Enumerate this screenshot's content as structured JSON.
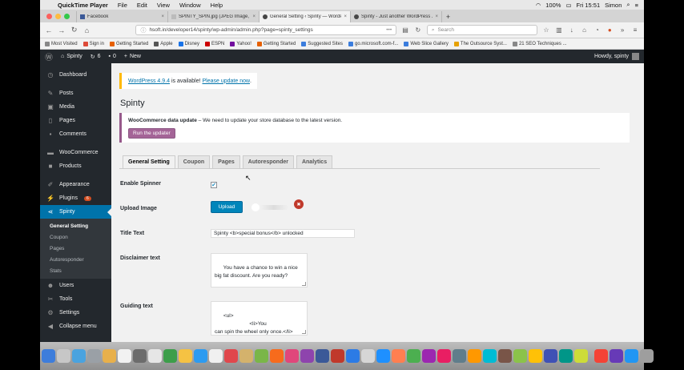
{
  "mac_menubar": {
    "app_name": "QuickTime Player",
    "menus": [
      "File",
      "Edit",
      "View",
      "Window",
      "Help"
    ],
    "battery": "100%",
    "clock": "Fri 15:51",
    "user": "Simon"
  },
  "browser": {
    "tabs": [
      {
        "title": "Facebook",
        "active": false
      },
      {
        "title": "SPINTY_SPIN.jpg (JPEG Image, 1...",
        "active": false
      },
      {
        "title": "General Setting ‹ Spinty — WordP...",
        "active": true
      },
      {
        "title": "Spinty - Just another WordPress ...",
        "active": false
      }
    ],
    "new_tab_label": "+",
    "url": "hsoft.in/developer14/spinty/wp-admin/admin.php?page=spinty_settings",
    "url_more": "•••",
    "search_placeholder": "Search",
    "bookmarks": [
      {
        "label": "Most Visited",
        "color": "#888888"
      },
      {
        "label": "Sign in",
        "color": "#dd4b39"
      },
      {
        "label": "Getting Started",
        "color": "#e66000"
      },
      {
        "label": "Apple",
        "color": "#555555"
      },
      {
        "label": "Disney",
        "color": "#1a73e8"
      },
      {
        "label": "ESPN",
        "color": "#cc0000"
      },
      {
        "label": "Yahoo!",
        "color": "#720e9e"
      },
      {
        "label": "Getting Started",
        "color": "#e66000"
      },
      {
        "label": "Suggested Sites",
        "color": "#3b7ddd"
      },
      {
        "label": "go.microsoft.com-f...",
        "color": "#3b7ddd"
      },
      {
        "label": "Web Slice Gallery",
        "color": "#3b7ddd"
      },
      {
        "label": "The Outsource Syst...",
        "color": "#e6a100"
      },
      {
        "label": "21 SEO Techniques ...",
        "color": "#888888"
      }
    ]
  },
  "wp_adminbar": {
    "site_name": "Spinty",
    "updates_count": "6",
    "comments_count": "0",
    "new_label": "New",
    "howdy": "Howdy, spinty"
  },
  "wp_sidebar": {
    "items": [
      {
        "label": "Dashboard",
        "icon": "dashboard-icon"
      },
      {
        "label": "Posts",
        "icon": "pin-icon"
      },
      {
        "label": "Media",
        "icon": "media-icon"
      },
      {
        "label": "Pages",
        "icon": "page-icon"
      },
      {
        "label": "Comments",
        "icon": "comment-icon"
      },
      {
        "label": "WooCommerce",
        "icon": "woo-icon"
      },
      {
        "label": "Products",
        "icon": "box-icon"
      },
      {
        "label": "Appearance",
        "icon": "brush-icon"
      },
      {
        "label": "Plugins",
        "icon": "plug-icon",
        "badge": "6"
      },
      {
        "label": "Spinty",
        "icon": "share-icon"
      },
      {
        "label": "Users",
        "icon": "user-icon"
      },
      {
        "label": "Tools",
        "icon": "wrench-icon"
      },
      {
        "label": "Settings",
        "icon": "settings-icon"
      },
      {
        "label": "Collapse menu",
        "icon": "collapse-icon"
      }
    ],
    "submenu": [
      "General Setting",
      "Coupon",
      "Pages",
      "Autoresponder",
      "Stats"
    ]
  },
  "content": {
    "update_notice": {
      "link1": "WordPress 4.9.4",
      "middle": " is available! ",
      "link2": "Please update now",
      "end": "."
    },
    "page_title": "Spinty",
    "woo_notice": {
      "strong": "WooCommerce data update",
      "text": " – We need to update your store database to the latest version.",
      "button": "Run the updater"
    },
    "tabs": [
      "General Setting",
      "Coupon",
      "Pages",
      "Autoresponder",
      "Analytics"
    ],
    "fields": {
      "enable_spinner_label": "Enable Spinner",
      "enable_spinner_check": "✔",
      "upload_image_label": "Upload Image",
      "upload_button": "Upload",
      "remove_glyph": "✖",
      "title_text_label": "Title Text",
      "title_text_value": "Spinty <b>special bonus</b> unlocked",
      "disclaimer_label": "Disclaimer text",
      "disclaimer_value": "You have a chance to win a nice\nbig fat discount. Are you ready?",
      "guiding_label": "Guiding text",
      "guiding_value": "<ul>\n                        <li>You\ncan spin the wheel only once.</li>\n                        <li>If you"
    }
  },
  "colors": {
    "wp_dark": "#23282d",
    "wp_blue": "#0073aa",
    "woo_purple": "#a46497",
    "update_yellow": "#ffb900"
  },
  "dock_icons": [
    "#3d7ddb",
    "#c7c7c7",
    "#4aa3df",
    "#9aa0a6",
    "#e8b04b",
    "#f2f2f2",
    "#6c6c6c",
    "#e6e6e6",
    "#3c9e4a",
    "#f5c243",
    "#2d9bf0",
    "#f0f0f0",
    "#e0474c",
    "#d4b26c",
    "#7ab648",
    "#f76b1c",
    "#e0477b",
    "#8e44ad",
    "#3b5998",
    "#c0392b",
    "#2c7be5",
    "#d6d6d6",
    "#1e90ff",
    "#ff7f50",
    "#4caf50",
    "#9c27b0",
    "#e91e63",
    "#607d8b",
    "#ff9800",
    "#00bcd4",
    "#795548",
    "#8bc34a",
    "#ffc107",
    "#3f51b5",
    "#009688",
    "#cddc39",
    "#f44336",
    "#673ab7",
    "#2196f3",
    "#9e9e9e"
  ]
}
